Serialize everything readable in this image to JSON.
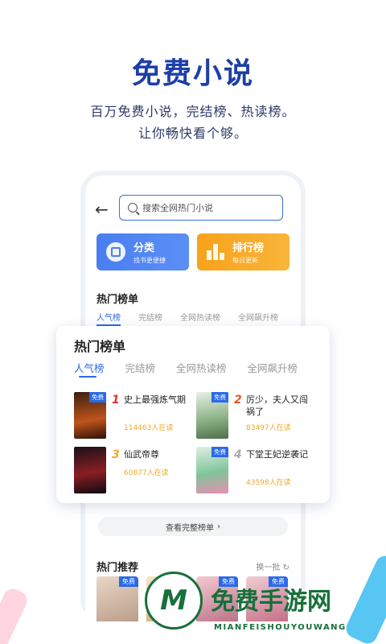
{
  "promo": {
    "title": "免费小说",
    "line1": "百万免费小说，完结榜、热读榜。",
    "line2": "让你畅快看个够。"
  },
  "app": {
    "search_placeholder": "搜索全网热门小说",
    "tiles": [
      {
        "label": "分类",
        "sub": "找书更便捷"
      },
      {
        "label": "排行榜",
        "sub": "每日更新"
      }
    ],
    "section_title": "热门榜单",
    "tabs": [
      "人气榜",
      "完结榜",
      "全网热读榜",
      "全网飙升榜"
    ],
    "view_full": "查看完整榜单",
    "recommend_title": "热门推荐",
    "refresh_label": "换一批",
    "recommend_tag": "免费"
  },
  "popup": {
    "title": "热门榜单",
    "tabs": [
      "人气榜",
      "完结榜",
      "全网热读榜",
      "全网飙升榜"
    ],
    "books": [
      {
        "rank": "1",
        "title": "史上最强炼气期",
        "readers": "114463人在读",
        "tag": "免费"
      },
      {
        "rank": "2",
        "title": "厉少，夫人又闯祸了",
        "readers": "83497人在读",
        "tag": "免费"
      },
      {
        "rank": "3",
        "title": "仙武帝尊",
        "readers": "60877人在读",
        "tag": "免费"
      },
      {
        "rank": "4",
        "title": "下堂王妃逆袭记",
        "readers": "43598人在读",
        "tag": "免费"
      }
    ]
  },
  "watermark": {
    "logo_letter": "M",
    "title": "免费手游网",
    "subtitle": "MIANFEISHOUYOUWANG"
  },
  "colors": {
    "accent_blue": "#2a6ae8",
    "title_blue": "#1d3fa8",
    "reader_orange": "#f0a92c",
    "rank1": "#e0322e",
    "rank2": "#e8552e",
    "rank3": "#f0a92c",
    "rank4": "#aaaaaa",
    "watermark_green": "#17703a"
  }
}
